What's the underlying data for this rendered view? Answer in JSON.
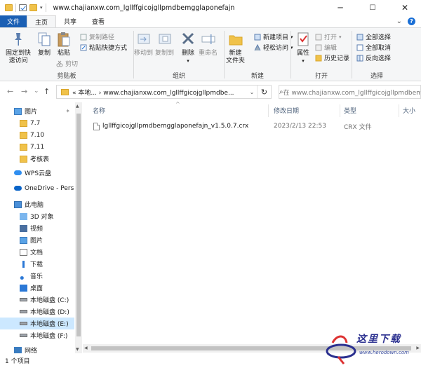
{
  "window": {
    "title": "www.chajianxw.com_lgllffgicojgllpmdbemgglaponefajn",
    "minimize_glyph": "─",
    "maximize_glyph": "☐",
    "close_glyph": "✕"
  },
  "qat": {
    "dropdown_glyph": "▾"
  },
  "tabs": {
    "file": "文件",
    "home": "主页",
    "share": "共享",
    "view": "查看",
    "expand_glyph": "⌄"
  },
  "ribbon": {
    "clipboard": {
      "label": "剪贴板",
      "pin": "固定到快\n速访问",
      "copy": "复制",
      "paste": "粘贴",
      "copy_path": "复制路径",
      "paste_shortcut": "粘贴快捷方式",
      "cut": "剪切"
    },
    "organize": {
      "label": "组织",
      "move_to": "移动到",
      "copy_to": "复制到",
      "delete": "删除",
      "rename": "重命名"
    },
    "new": {
      "label": "新建",
      "new_folder": "新建\n文件夹",
      "new_item": "新建项目",
      "easy_access": "轻松访问"
    },
    "open": {
      "label": "打开",
      "properties": "属性",
      "open": "打开",
      "edit": "编辑",
      "history": "历史记录"
    },
    "select": {
      "label": "选择",
      "select_all": "全部选择",
      "select_none": "全部取消",
      "invert": "反向选择"
    }
  },
  "address": {
    "back": "←",
    "forward": "→",
    "recent": "⌄",
    "up": "↑",
    "path": "«  本地...  ›  www.chajianxw.com_lgllffgicojgllpmdbe...",
    "dropdown": "⌄",
    "refresh": "↻",
    "search_placeholder": "在 www.chajianxw.com_lgllffgicojgllpmdbemggla..."
  },
  "nav": {
    "items": [
      {
        "label": "图片",
        "icon": "pictures-icon"
      },
      {
        "label": "7.7",
        "icon": "folder-icon"
      },
      {
        "label": "7.10",
        "icon": "folder-icon"
      },
      {
        "label": "7.11",
        "icon": "folder-icon"
      },
      {
        "label": "考核表",
        "icon": "folder-icon"
      },
      {
        "label": "WPS云盘",
        "icon": "cloud-icon"
      },
      {
        "label": "OneDrive - Person",
        "icon": "onedrive-icon"
      },
      {
        "label": "此电脑",
        "icon": "computer-icon"
      },
      {
        "label": "3D 对象",
        "icon": "3d-objects-icon"
      },
      {
        "label": "视频",
        "icon": "videos-icon"
      },
      {
        "label": "图片",
        "icon": "pictures-icon"
      },
      {
        "label": "文档",
        "icon": "documents-icon"
      },
      {
        "label": "下载",
        "icon": "downloads-icon"
      },
      {
        "label": "音乐",
        "icon": "music-icon"
      },
      {
        "label": "桌面",
        "icon": "desktop-icon"
      },
      {
        "label": "本地磁盘 (C:)",
        "icon": "drive-icon"
      },
      {
        "label": "本地磁盘 (D:)",
        "icon": "drive-icon"
      },
      {
        "label": "本地磁盘 (E:)",
        "icon": "drive-icon"
      },
      {
        "label": "本地磁盘 (F:)",
        "icon": "drive-icon"
      },
      {
        "label": "网络",
        "icon": "network-icon"
      }
    ],
    "pin_glyph": "📌"
  },
  "columns": {
    "name": "名称",
    "date": "修改日期",
    "type": "类型",
    "size": "大小",
    "sort_glyph": "^"
  },
  "files": [
    {
      "name": "lgllffgicojgllpmdbemgglaponefajn_v1.5.0.7.crx",
      "date": "2023/2/13 22:53",
      "type": "CRX 文件"
    }
  ],
  "status": {
    "count": "1 个项目"
  },
  "watermark": {
    "text": "这里下载",
    "url": "www.herodown.com"
  },
  "colors": {
    "accent": "#1a5fb4",
    "selected": "#cce8ff",
    "folder": "#f0c24a"
  }
}
